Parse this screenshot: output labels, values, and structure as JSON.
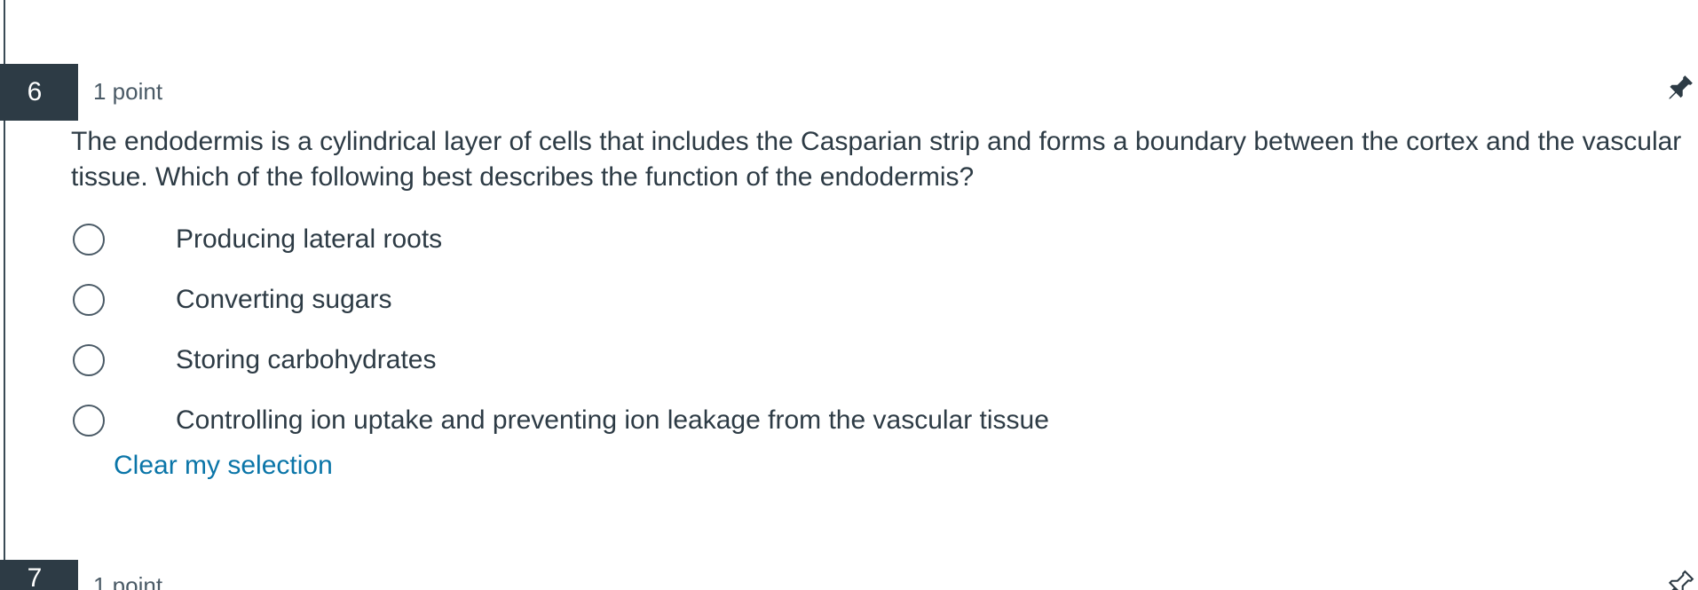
{
  "question_6": {
    "number": "6",
    "points": "1 point",
    "text": "The endodermis is a cylindrical layer of cells that includes the Casparian strip and forms a boundary between the cortex and the vascular tissue. Which of the following best describes the function of the endodermis?",
    "pinned": true,
    "pin_icon": "pin-icon",
    "answers": [
      {
        "label": "Producing lateral roots",
        "selected": false
      },
      {
        "label": "Converting sugars",
        "selected": false
      },
      {
        "label": "Storing carbohydrates",
        "selected": false
      },
      {
        "label": "Controlling ion uptake and preventing ion leakage from the vascular tissue",
        "selected": false
      }
    ],
    "clear_label": "Clear my selection"
  },
  "question_7": {
    "number": "7",
    "points": "1 point",
    "pinned": false,
    "pin_icon": "pin-outline-icon"
  },
  "colors": {
    "number_bg": "#2d3b45",
    "text": "#2d3b45",
    "link": "#0a75a8"
  }
}
